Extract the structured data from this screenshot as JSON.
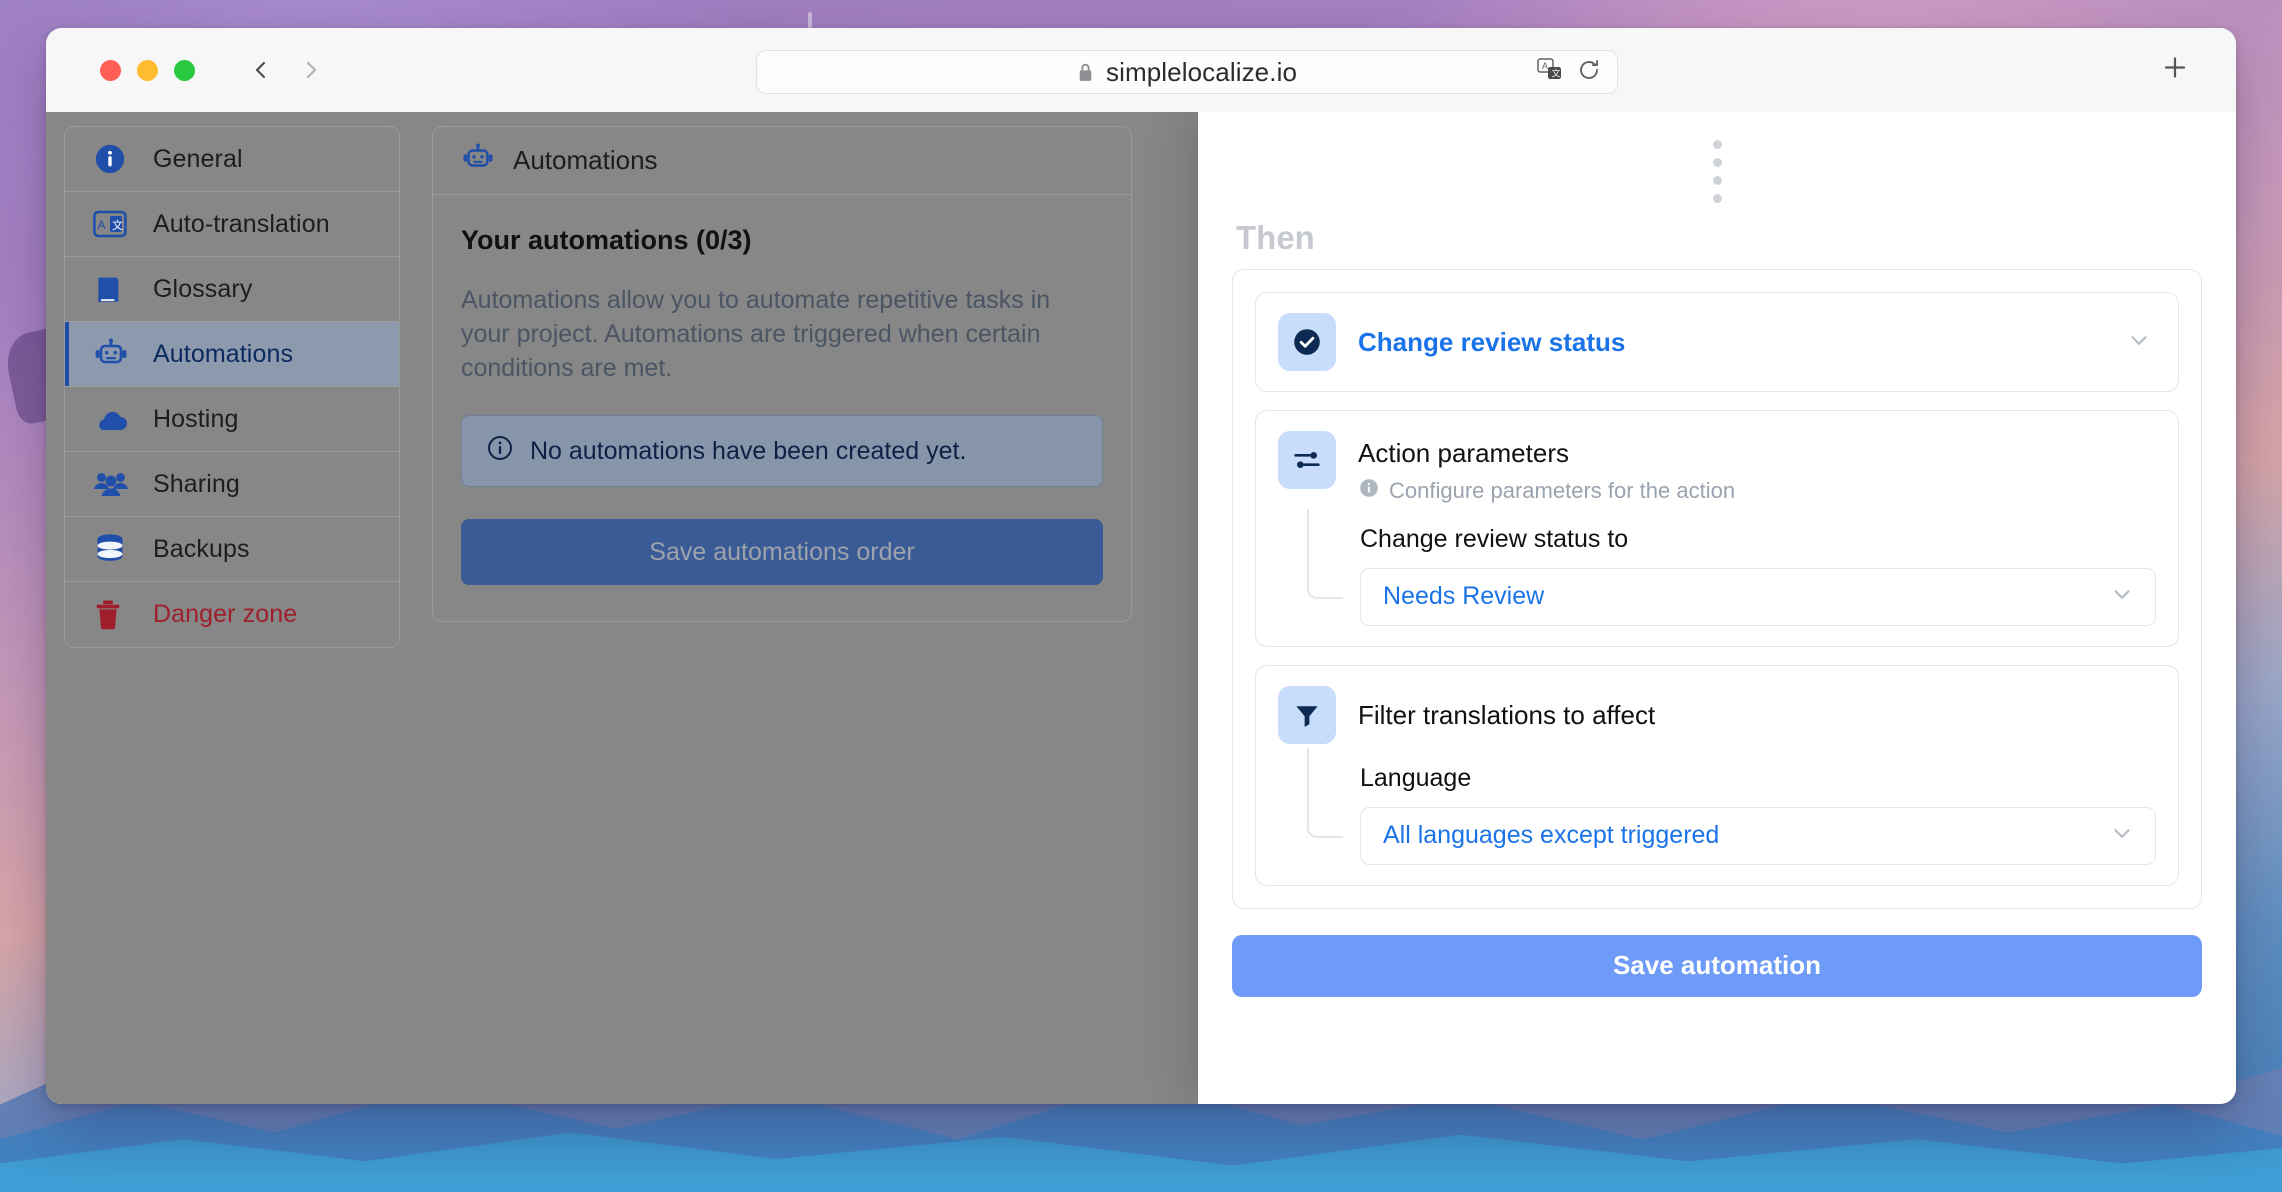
{
  "browser": {
    "url": "simplelocalize.io",
    "lock_icon": "lock-icon",
    "back_icon": "chevron-left-icon",
    "forward_icon": "chevron-right-icon",
    "translate_icon": "translate-icon",
    "reload_icon": "reload-icon",
    "newtab_icon": "plus-icon",
    "traffic": {
      "close": "close-window-button",
      "minimize": "minimize-window-button",
      "zoom": "zoom-window-button"
    }
  },
  "sidebar": {
    "items": [
      {
        "label": "General",
        "icon": "info-circle-icon",
        "active": false,
        "danger": false
      },
      {
        "label": "Auto-translation",
        "icon": "translate-box-icon",
        "active": false,
        "danger": false
      },
      {
        "label": "Glossary",
        "icon": "book-icon",
        "active": false,
        "danger": false
      },
      {
        "label": "Automations",
        "icon": "robot-icon",
        "active": true,
        "danger": false
      },
      {
        "label": "Hosting",
        "icon": "cloud-icon",
        "active": false,
        "danger": false
      },
      {
        "label": "Sharing",
        "icon": "people-icon",
        "active": false,
        "danger": false
      },
      {
        "label": "Backups",
        "icon": "database-icon",
        "active": false,
        "danger": false
      },
      {
        "label": "Danger zone",
        "icon": "trash-icon",
        "active": false,
        "danger": true
      }
    ]
  },
  "main": {
    "header_label": "Automations",
    "header_icon": "robot-icon",
    "title": "Your automations (0/3)",
    "description": "Automations allow you to automate repetitive tasks in your project. Automations are triggered when certain conditions are met.",
    "alert": {
      "icon": "info-circle-icon",
      "text": "No automations have been created yet."
    },
    "order_button": "Save automations order"
  },
  "drawer": {
    "drag_handle_icon": "drag-dots-icon",
    "section_label": "Then",
    "action": {
      "icon": "check-circle-icon",
      "title": "Change review status",
      "chevron": "chevron-down-icon"
    },
    "parameters": {
      "icon": "sliders-icon",
      "title": "Action parameters",
      "subtitle_icon": "info-circle-icon",
      "subtitle": "Configure parameters for the action",
      "field_label": "Change review status to",
      "field_value": "Needs Review",
      "field_chevron": "chevron-down-icon"
    },
    "filter": {
      "icon": "funnel-icon",
      "title": "Filter translations to affect",
      "field_label": "Language",
      "field_value": "All languages except triggered",
      "field_chevron": "chevron-down-icon"
    },
    "save_button": "Save automation"
  },
  "colors": {
    "accent_blue": "#1a73e8",
    "icon_blue": "#1c4ea8",
    "icon_tile_bg": "#c7ddfb",
    "save_button_bg": "#6e9bf7",
    "danger_red": "#9e1f2b",
    "order_button_bg": "#3a5b96"
  }
}
